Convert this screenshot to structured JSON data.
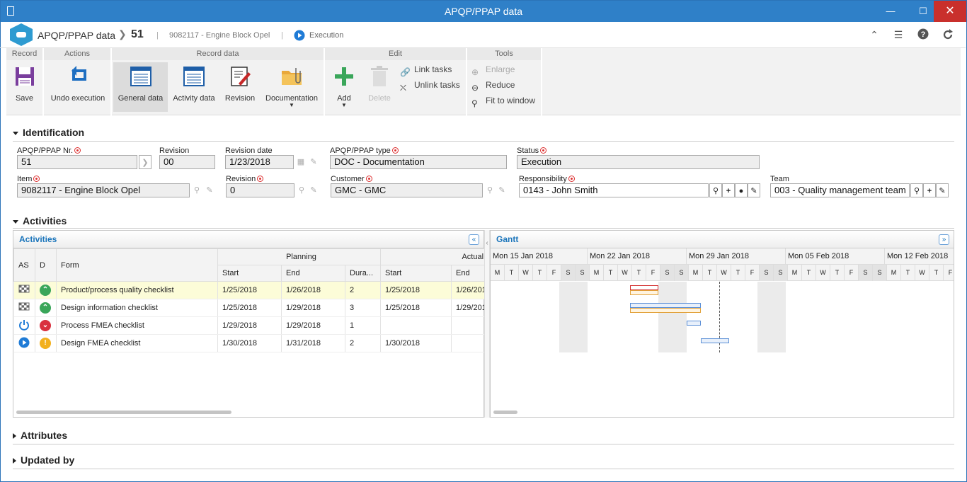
{
  "window": {
    "title": "APQP/PPAP data"
  },
  "header": {
    "app": "APQP/PPAP data",
    "record_number": "51",
    "separator": "|",
    "item": "9082117 - Engine Block Opel",
    "status": "Execution"
  },
  "ribbon": {
    "groups": {
      "record": "Record",
      "actions": "Actions",
      "record_data": "Record data",
      "edit": "Edit",
      "tools": "Tools"
    },
    "save": "Save",
    "undo": "Undo execution",
    "general": "General data",
    "activity": "Activity data",
    "revision": "Revision",
    "documentation": "Documentation",
    "add": "Add",
    "delete": "Delete",
    "link": "Link tasks",
    "unlink": "Unlink tasks",
    "enlarge": "Enlarge",
    "reduce": "Reduce",
    "fit": "Fit to window"
  },
  "identification": {
    "title": "Identification",
    "apqp_nr_label": "APQP/PPAP Nr.",
    "apqp_nr": "51",
    "revision_label": "Revision",
    "revision": "00",
    "revision_date_label": "Revision date",
    "revision_date": "1/23/2018",
    "type_label": "APQP/PPAP type",
    "type": "DOC - Documentation",
    "status_label": "Status",
    "status": "Execution",
    "item_label": "Item",
    "item": "9082117 - Engine Block Opel",
    "item_rev_label": "Revision",
    "item_rev": "0",
    "customer_label": "Customer",
    "customer": "GMC - GMC",
    "responsibility_label": "Responsibility",
    "responsibility": "0143 - John Smith",
    "team_label": "Team",
    "team": "003 - Quality management team"
  },
  "activities": {
    "title": "Activities",
    "panel_title": "Activities",
    "gantt_title": "Gantt",
    "headers": {
      "as": "AS",
      "d": "D",
      "form": "Form",
      "planning": "Planning",
      "actual": "Actual",
      "start": "Start",
      "end": "End",
      "duration": "Dura..."
    },
    "rows": [
      {
        "form": "Product/process quality checklist",
        "p_start": "1/25/2018",
        "p_end": "1/26/2018",
        "dur": "2",
        "a_start": "1/25/2018",
        "a_end": "1/26/201"
      },
      {
        "form": "Design information checklist",
        "p_start": "1/25/2018",
        "p_end": "1/29/2018",
        "dur": "3",
        "a_start": "1/25/2018",
        "a_end": "1/29/201"
      },
      {
        "form": "Process FMEA checklist",
        "p_start": "1/29/2018",
        "p_end": "1/29/2018",
        "dur": "1",
        "a_start": "",
        "a_end": ""
      },
      {
        "form": "Design FMEA checklist",
        "p_start": "1/30/2018",
        "p_end": "1/31/2018",
        "dur": "2",
        "a_start": "1/30/2018",
        "a_end": ""
      }
    ],
    "weeks": [
      "Mon 15 Jan 2018",
      "Mon 22 Jan 2018",
      "Mon 29 Jan 2018",
      "Mon 05 Feb 2018",
      "Mon 12 Feb 2018"
    ],
    "days": [
      "M",
      "T",
      "W",
      "T",
      "F",
      "S",
      "S"
    ]
  },
  "attributes": {
    "title": "Attributes"
  },
  "updated": {
    "title": "Updated by"
  }
}
